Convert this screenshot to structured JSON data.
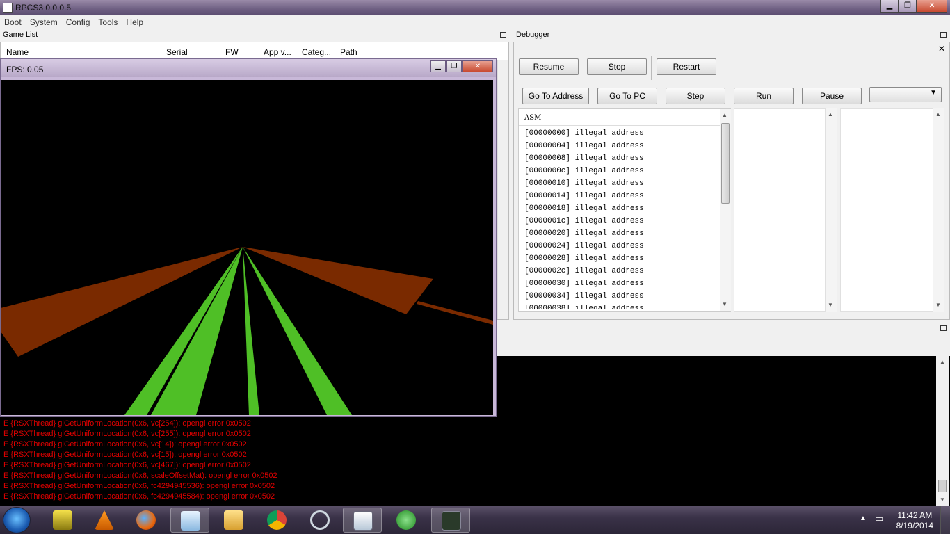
{
  "window": {
    "title": "RPCS3 0.0.0.5",
    "minimize": "▁",
    "maximize": "❐",
    "close": "✕"
  },
  "menu": [
    "Boot",
    "System",
    "Config",
    "Tools",
    "Help"
  ],
  "game_list": {
    "title": "Game List",
    "columns": [
      "Name",
      "Serial",
      "FW",
      "App v...",
      "Categ...",
      "Path"
    ]
  },
  "debugger": {
    "title": "Debugger",
    "buttons_row1": [
      "Resume",
      "Stop",
      "Restart"
    ],
    "buttons_row2": [
      "Go To Address",
      "Go To PC",
      "Step",
      "Run",
      "Pause"
    ],
    "dropdown_value": "",
    "asm_header": "ASM",
    "asm_lines": [
      "[00000000] illegal address",
      "[00000004] illegal address",
      "[00000008] illegal address",
      "[0000000c] illegal address",
      "[00000010] illegal address",
      "[00000014] illegal address",
      "[00000018] illegal address",
      "[0000001c] illegal address",
      "[00000020] illegal address",
      "[00000024] illegal address",
      "[00000028] illegal address",
      "[0000002c] illegal address",
      "[00000030] illegal address",
      "[00000034] illegal address",
      "[00000038] illegal address"
    ]
  },
  "rsx_window": {
    "title": "FPS: 0.05",
    "colors": {
      "green": "#4fbf26",
      "brown": "#7a2a00",
      "background": "#000000"
    }
  },
  "log": {
    "color": "#e00000",
    "lines": [
      "E {RSXThread} glGetUniformLocation(0x6, vc[254]): opengl error 0x0502",
      "E {RSXThread} glGetUniformLocation(0x6, vc[255]): opengl error 0x0502",
      "E {RSXThread} glGetUniformLocation(0x6, vc[14]): opengl error 0x0502",
      "E {RSXThread} glGetUniformLocation(0x6, vc[15]): opengl error 0x0502",
      "E {RSXThread} glGetUniformLocation(0x6, vc[467]): opengl error 0x0502",
      "E {RSXThread} glGetUniformLocation(0x6, scaleOffsetMat): opengl error 0x0502",
      "E {RSXThread} glGetUniformLocation(0x6, fc4294945536): opengl error 0x0502",
      "E {RSXThread} glGetUniformLocation(0x6, fc4294945584): opengl error 0x0502"
    ]
  },
  "taskbar": {
    "time": "11:42 AM",
    "date": "8/19/2014",
    "items": [
      "winamp-icon",
      "vlc-icon",
      "firefox-icon",
      "notepad-icon",
      "explorer-icon",
      "chrome-icon",
      "ccleaner-icon",
      "rpcs3-icon",
      "network-icon",
      "terminal-icon"
    ]
  }
}
